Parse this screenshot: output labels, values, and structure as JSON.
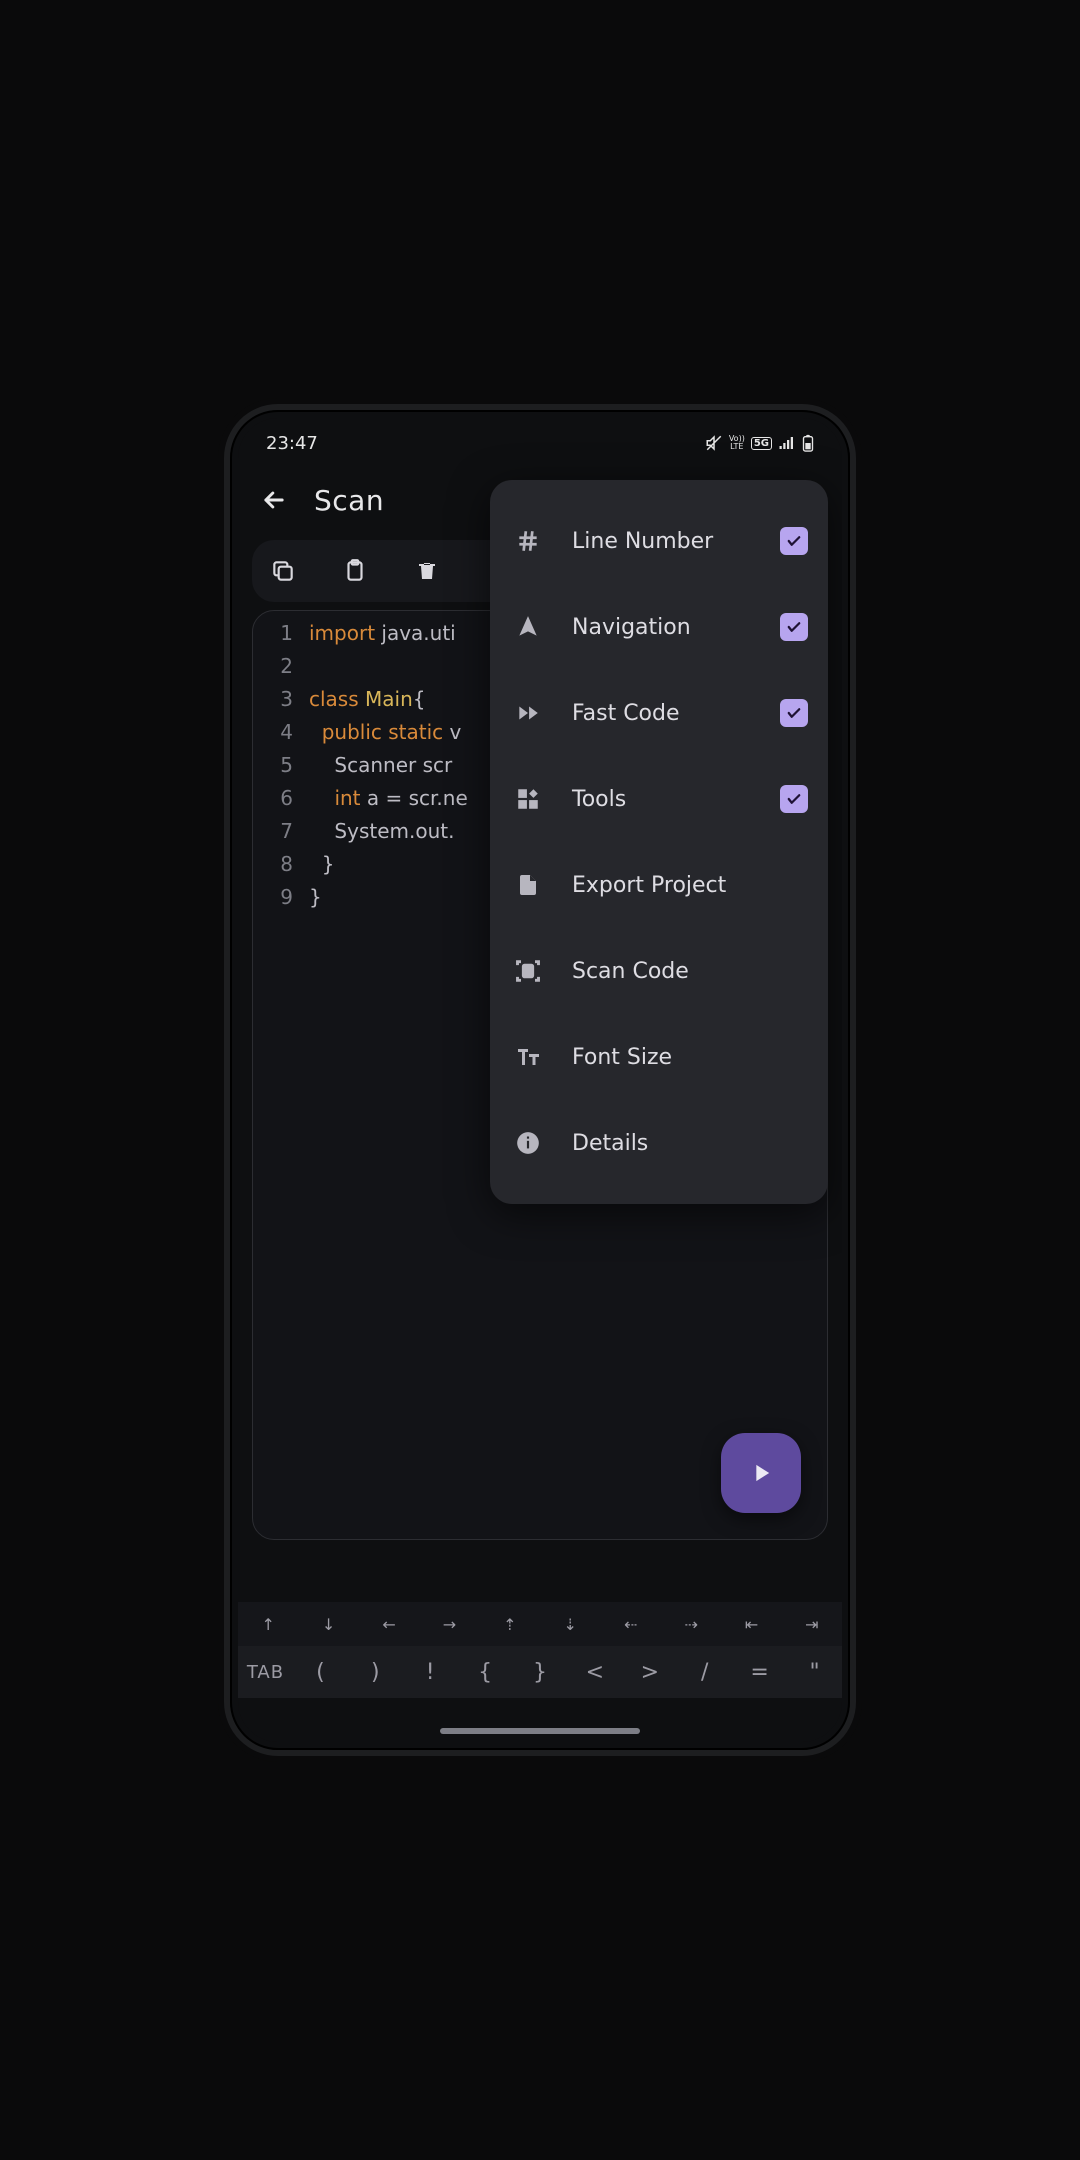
{
  "status": {
    "time": "23:47",
    "lte": "Vo))\nLTE",
    "net": "5G"
  },
  "appbar": {
    "title": "Scan"
  },
  "menu": {
    "items": [
      {
        "label": "Line Number",
        "checked": true,
        "icon": "hash"
      },
      {
        "label": "Navigation",
        "checked": true,
        "icon": "nav"
      },
      {
        "label": "Fast Code",
        "checked": true,
        "icon": "ff"
      },
      {
        "label": "Tools",
        "checked": true,
        "icon": "tools"
      },
      {
        "label": "Export Project",
        "checked": false,
        "icon": "export"
      },
      {
        "label": "Scan Code",
        "checked": false,
        "icon": "scan"
      },
      {
        "label": "Font Size",
        "checked": false,
        "icon": "font"
      },
      {
        "label": "Details",
        "checked": false,
        "icon": "info"
      }
    ]
  },
  "code": {
    "lines": [
      {
        "n": "1",
        "tokens": [
          [
            "kw1",
            "import"
          ],
          [
            "id",
            " java.uti"
          ]
        ]
      },
      {
        "n": "2",
        "tokens": [
          [
            "id",
            ""
          ]
        ]
      },
      {
        "n": "3",
        "tokens": [
          [
            "kw1",
            "class"
          ],
          [
            "id",
            " "
          ],
          [
            "cls",
            "Main"
          ],
          [
            "id",
            "{"
          ]
        ]
      },
      {
        "n": "4",
        "tokens": [
          [
            "id",
            "  "
          ],
          [
            "kw2",
            "public static"
          ],
          [
            "id",
            " v"
          ]
        ]
      },
      {
        "n": "5",
        "tokens": [
          [
            "id",
            "    Scanner scr"
          ]
        ]
      },
      {
        "n": "6",
        "tokens": [
          [
            "id",
            "    "
          ],
          [
            "typ",
            "int"
          ],
          [
            "id",
            " a = scr.ne"
          ]
        ]
      },
      {
        "n": "7",
        "tokens": [
          [
            "id",
            "    System.out."
          ]
        ]
      },
      {
        "n": "8",
        "tokens": [
          [
            "id",
            "  }"
          ]
        ]
      },
      {
        "n": "9",
        "tokens": [
          [
            "id",
            "}"
          ]
        ]
      }
    ]
  },
  "keybar1": [
    "↑",
    "↓",
    "←",
    "→",
    "⇡",
    "⇣",
    "⇠",
    "⇢",
    "⇤",
    "⇥"
  ],
  "keybar2": [
    "TAB",
    "(",
    ")",
    "!",
    "{",
    "}",
    "<",
    ">",
    "/",
    "=",
    "\""
  ]
}
